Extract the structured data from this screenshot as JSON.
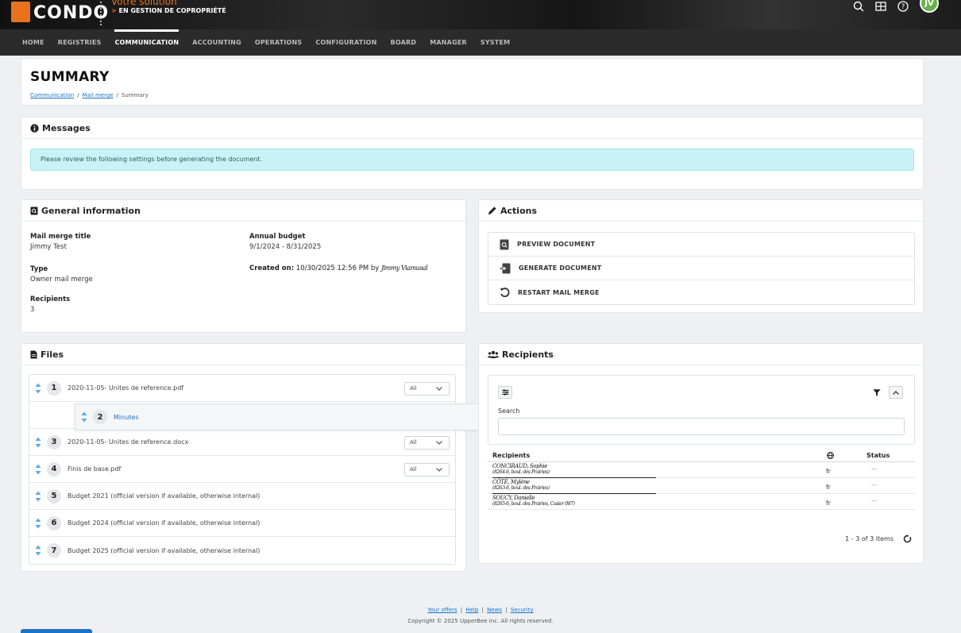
{
  "branding": {
    "logo_text": "CONDO",
    "tagline_top": "Votre solution",
    "tagline_arrow": ">",
    "tagline_bottom": "EN GESTION DE COPROPRIÉTÉ"
  },
  "header": {
    "avatar_initials": "JV",
    "icons": [
      "search-icon",
      "grid-icon",
      "help-icon"
    ]
  },
  "nav": {
    "items": [
      "HOME",
      "REGISTRIES",
      "COMMUNICATION",
      "ACCOUNTING",
      "OPERATIONS",
      "CONFIGURATION",
      "BOARD",
      "MANAGER",
      "SYSTEM"
    ],
    "active_index": 2
  },
  "page": {
    "title": "SUMMARY",
    "breadcrumb": [
      "Communication",
      "Mail merge",
      "Summary"
    ]
  },
  "messages": {
    "header": "Messages",
    "alert": "Please review the following settings before generating the document."
  },
  "general": {
    "header": "General information",
    "title_label": "Mail merge title",
    "title_value": "Jimmy Test",
    "type_label": "Type",
    "type_value": "Owner mail merge",
    "recipients_label": "Recipients",
    "recipients_value": "3",
    "budget_label": "Annual budget",
    "budget_value": "9/1/2024 - 8/31/2025",
    "created_label": "Created on:",
    "created_value": "10/30/2025 12:56 PM by",
    "created_by": "Jimmy Viamusal"
  },
  "actions": {
    "header": "Actions",
    "items": [
      "PREVIEW DOCUMENT",
      "GENERATE DOCUMENT",
      "RESTART MAIL MERGE"
    ]
  },
  "files": {
    "header": "Files",
    "items": [
      {
        "num": "1",
        "name": "2020-11-05- Unites de reference.pdf",
        "select": "All"
      },
      {
        "num": "3",
        "name": "2020-11-05- Unites de reference.docx",
        "select": "All"
      },
      {
        "num": "4",
        "name": "Finis de base.pdf",
        "select": "All"
      },
      {
        "num": "5",
        "name": "Budget 2021 (official version if available, otherwise internal)"
      },
      {
        "num": "6",
        "name": "Budget 2024 (official version if available, otherwise internal)"
      },
      {
        "num": "7",
        "name": "Budget 2025 (official version if available, otherwise internal)"
      }
    ],
    "dragging": {
      "num": "2",
      "name": "Minutes"
    }
  },
  "recipients": {
    "header": "Recipients",
    "search_label": "Search",
    "search_value": "",
    "col_recipients": "Recipients",
    "col_status": "Status",
    "rows": [
      {
        "name": "CONCIRAUD, Sophie",
        "addr": "(8264-6, boul. des Prairies)",
        "lang": "fr",
        "status": "—"
      },
      {
        "name": "CÔTÉ, Mylène",
        "addr": "(8263-6, boul. des Prairies)",
        "lang": "fr",
        "status": "—"
      },
      {
        "name": "SOUCY, Danielle",
        "addr": "(8265-6, boul. des Prairies, Casier 087)",
        "lang": "fr",
        "status": "—"
      }
    ],
    "pager": "1 - 3 of 3 items"
  },
  "footer": {
    "links": [
      "Your offers",
      "Help",
      "News",
      "Security"
    ],
    "copyright": "Copyright © 2025 UpperBee inc. All rights reserved."
  },
  "colors": {
    "accent": "#e8731c",
    "link": "#1a73c9",
    "alert_bg": "#c9f2f7",
    "avatar": "#6ab04c"
  }
}
